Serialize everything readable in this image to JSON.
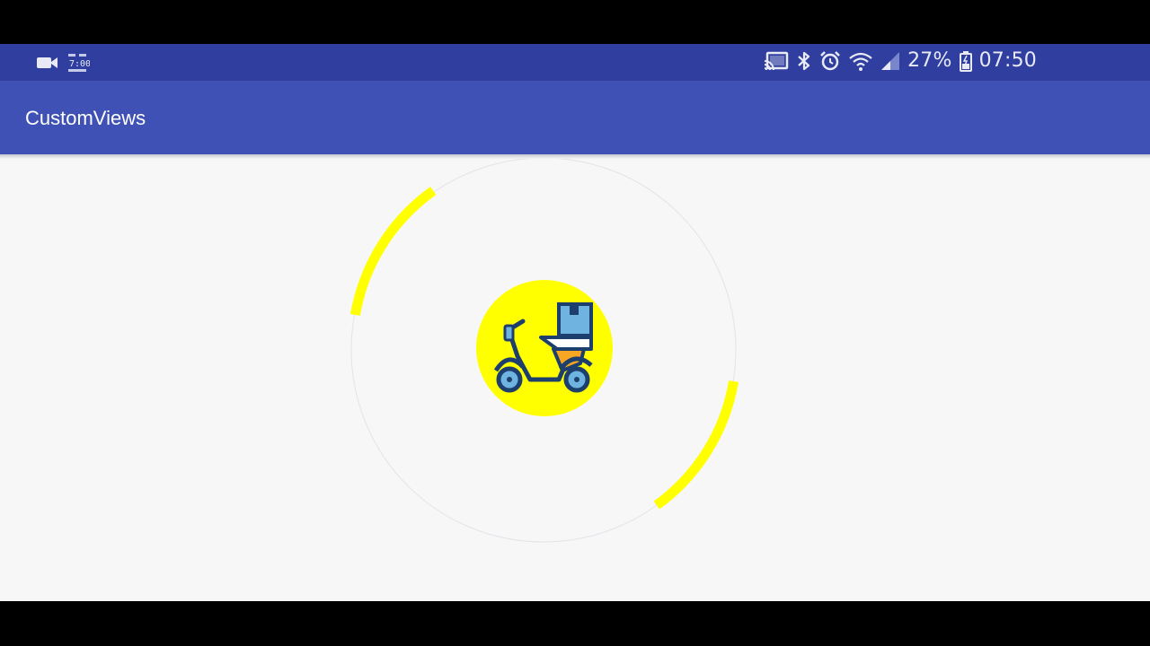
{
  "status_bar": {
    "left_icons": [
      "video-camera-icon",
      "notification-clock-icon"
    ],
    "right_icons": [
      "cast-icon",
      "bluetooth-icon",
      "alarm-icon",
      "wifi-icon",
      "cellular-signal-icon",
      "battery-icon"
    ],
    "battery_percent": "27%",
    "time": "07:50",
    "background": "#303f9f"
  },
  "app_bar": {
    "title": "CustomViews",
    "background": "#3f51b5"
  },
  "loader": {
    "arc_color": "#ffff00",
    "ring_color": "#e0e0e6",
    "center_icon": "delivery-scooter-icon",
    "center_bg": "#ffff00"
  }
}
